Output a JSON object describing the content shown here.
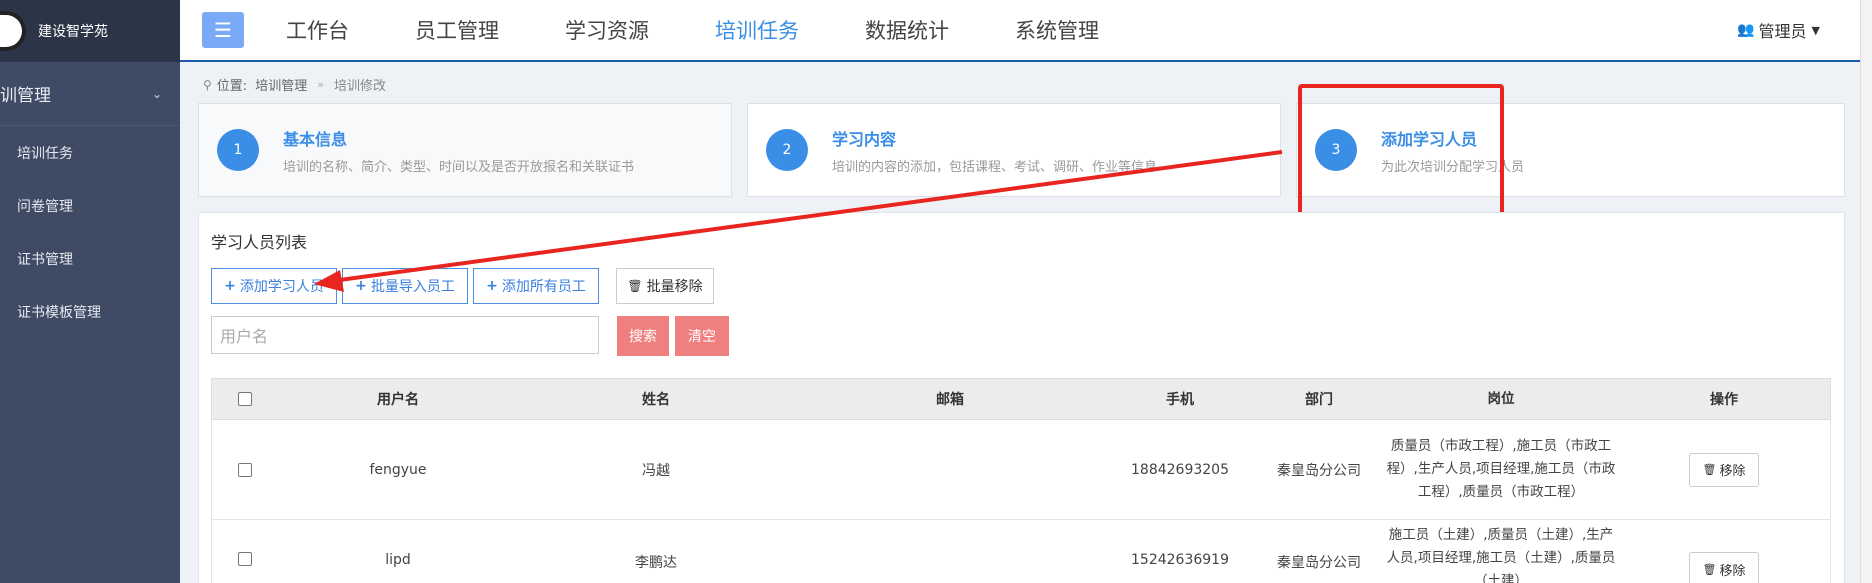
{
  "brand": {
    "name": "建设智学苑"
  },
  "sidebar": {
    "group_label": "训管理",
    "items": [
      {
        "label": "培训任务"
      },
      {
        "label": "问卷管理"
      },
      {
        "label": "证书管理"
      },
      {
        "label": "证书模板管理"
      }
    ]
  },
  "nav": {
    "items": [
      {
        "label": "工作台"
      },
      {
        "label": "员工管理"
      },
      {
        "label": "学习资源"
      },
      {
        "label": "培训任务",
        "active": true
      },
      {
        "label": "数据统计"
      },
      {
        "label": "系统管理"
      }
    ],
    "user_label": "管理员"
  },
  "breadcrumb": {
    "prefix": "位置:",
    "parent": "培训管理",
    "separator": "»",
    "current": "培训修改"
  },
  "steps": [
    {
      "number": "1",
      "title": "基本信息",
      "desc": "培训的名称、简介、类型、时间以及是否开放报名和关联证书"
    },
    {
      "number": "2",
      "title": "学习内容",
      "desc": "培训的内容的添加，包括课程、考试、调研、作业等信息"
    },
    {
      "number": "3",
      "title": "添加学习人员",
      "desc": "为此次培训分配学习人员"
    }
  ],
  "panel": {
    "title": "学习人员列表",
    "buttons": {
      "add_learner": "添加学习人员",
      "batch_import": "批量导入员工",
      "add_all": "添加所有员工",
      "batch_remove": "批量移除"
    },
    "search": {
      "placeholder": "用户名",
      "search_label": "搜索",
      "clear_label": "清空"
    }
  },
  "table": {
    "headers": [
      "用户名",
      "姓名",
      "邮箱",
      "手机",
      "部门",
      "岗位",
      "操作"
    ],
    "rows": [
      {
        "username": "fengyue",
        "name": "冯越",
        "email": "",
        "phone": "18842693205",
        "dept": "秦皇岛分公司",
        "position": "质量员（市政工程）,施工员（市政工程）,生产人员,项目经理,施工员（市政工程）,质量员（市政工程）",
        "action": "移除"
      },
      {
        "username": "lipd",
        "name": "李鹏达",
        "email": "",
        "phone": "15242636919",
        "dept": "秦皇岛分公司",
        "position": "施工员（土建）,质量员（土建）,生产人员,项目经理,施工员（土建）,质量员（土建）",
        "action": "移除"
      }
    ]
  },
  "colors": {
    "accent": "#3a8ee6",
    "sidebar": "#3f4b64",
    "annotation": "#e8251f",
    "search_button": "#f08080"
  }
}
